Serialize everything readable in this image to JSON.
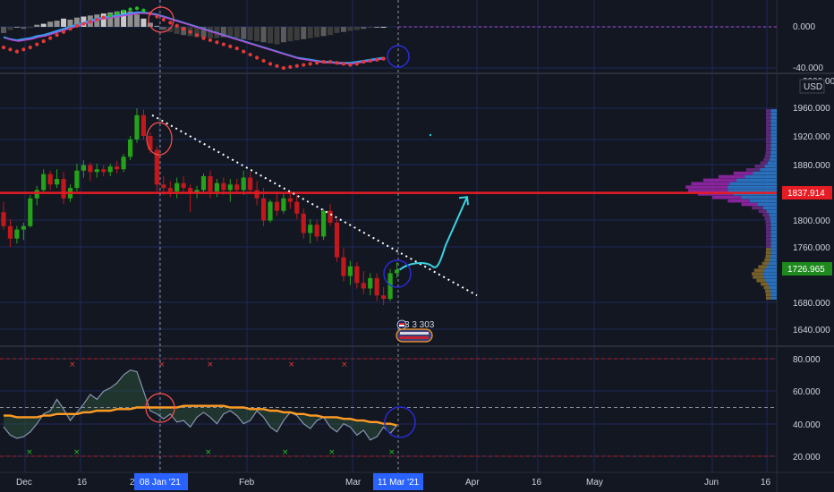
{
  "colors": {
    "background": "#131722",
    "grid": "#1e2a5a",
    "candle_up": "#26a21a",
    "candle_down": "#c2181b",
    "resistance": "#e51c23",
    "forecast": "#3ad2e0",
    "macd_signal": "#b34bd1",
    "macd_line": "#2ea1f2",
    "rsi_ma": "#ff9b24",
    "rsi_line": "#8795b0",
    "marker_circle_red": "#ff5050",
    "marker_circle_blue": "#2b2bd6"
  },
  "header": {
    "currency": "USD"
  },
  "x_axis": {
    "labels": [
      "Dec",
      "16",
      "2",
      "Feb",
      "Mar",
      "Apr",
      "16",
      "May",
      "Jun",
      "16"
    ],
    "highlight_labels": [
      "08 Jan '21",
      "11 Mar '21"
    ]
  },
  "price_panel": {
    "y_ticks": [
      "1960.000",
      "1920.000",
      "1880.000",
      "1800.000",
      "1760.000",
      "1680.000",
      "1640.000"
    ],
    "partial_top_label": "2000.000",
    "resistance_label": "1837.914",
    "last_price_label": "1726.965",
    "badge_text": "3 3 303",
    "icon_names": [
      "flag-icon",
      "event-icon"
    ]
  },
  "macd_panel": {
    "y_ticks": [
      "0.000",
      "-40.000"
    ]
  },
  "rsi_panel": {
    "y_ticks": [
      "80.000",
      "60.000",
      "40.000",
      "20.000"
    ]
  },
  "chart_data": [
    {
      "type": "candlestick",
      "title": "",
      "ylim": [
        1620,
        2000
      ],
      "resistance_level": 1837.914,
      "last_price": 1726.965,
      "candles": [
        [
          1810,
          1825,
          1785,
          1790
        ],
        [
          1790,
          1800,
          1760,
          1772
        ],
        [
          1772,
          1790,
          1765,
          1785
        ],
        [
          1785,
          1795,
          1770,
          1790
        ],
        [
          1790,
          1835,
          1788,
          1830
        ],
        [
          1830,
          1848,
          1820,
          1842
        ],
        [
          1842,
          1872,
          1838,
          1865
        ],
        [
          1865,
          1870,
          1842,
          1850
        ],
        [
          1850,
          1872,
          1845,
          1858
        ],
        [
          1858,
          1868,
          1822,
          1830
        ],
        [
          1830,
          1850,
          1825,
          1845
        ],
        [
          1845,
          1880,
          1840,
          1870
        ],
        [
          1870,
          1885,
          1860,
          1878
        ],
        [
          1878,
          1882,
          1855,
          1868
        ],
        [
          1868,
          1880,
          1860,
          1872
        ],
        [
          1872,
          1878,
          1862,
          1868
        ],
        [
          1868,
          1880,
          1862,
          1876
        ],
        [
          1876,
          1884,
          1866,
          1872
        ],
        [
          1872,
          1894,
          1868,
          1890
        ],
        [
          1890,
          1920,
          1885,
          1915
        ],
        [
          1915,
          1960,
          1910,
          1950
        ],
        [
          1950,
          1958,
          1915,
          1920
        ],
        [
          1920,
          1925,
          1895,
          1900
        ],
        [
          1900,
          1905,
          1840,
          1850
        ],
        [
          1850,
          1862,
          1835,
          1845
        ],
        [
          1845,
          1855,
          1832,
          1840
        ],
        [
          1840,
          1860,
          1830,
          1852
        ],
        [
          1852,
          1862,
          1838,
          1845
        ],
        [
          1845,
          1850,
          1810,
          1838
        ],
        [
          1838,
          1848,
          1830,
          1842
        ],
        [
          1842,
          1866,
          1838,
          1862
        ],
        [
          1862,
          1870,
          1830,
          1840
        ],
        [
          1840,
          1858,
          1832,
          1852
        ],
        [
          1852,
          1860,
          1835,
          1842
        ],
        [
          1842,
          1858,
          1825,
          1850
        ],
        [
          1850,
          1858,
          1838,
          1842
        ],
        [
          1842,
          1870,
          1835,
          1860
        ],
        [
          1860,
          1868,
          1838,
          1842
        ],
        [
          1842,
          1855,
          1820,
          1830
        ],
        [
          1830,
          1845,
          1790,
          1798
        ],
        [
          1798,
          1828,
          1795,
          1825
        ],
        [
          1825,
          1840,
          1805,
          1812
        ],
        [
          1812,
          1836,
          1808,
          1830
        ],
        [
          1830,
          1840,
          1815,
          1825
        ],
        [
          1825,
          1835,
          1800,
          1808
        ],
        [
          1808,
          1815,
          1772,
          1780
        ],
        [
          1780,
          1800,
          1765,
          1792
        ],
        [
          1792,
          1798,
          1768,
          1775
        ],
        [
          1775,
          1815,
          1770,
          1812
        ],
        [
          1812,
          1822,
          1790,
          1795
        ],
        [
          1795,
          1800,
          1738,
          1745
        ],
        [
          1745,
          1758,
          1710,
          1718
        ],
        [
          1718,
          1740,
          1705,
          1732
        ],
        [
          1732,
          1738,
          1700,
          1708
        ],
        [
          1708,
          1725,
          1692,
          1700
        ],
        [
          1700,
          1722,
          1690,
          1715
        ],
        [
          1715,
          1722,
          1682,
          1690
        ],
        [
          1690,
          1702,
          1676,
          1685
        ],
        [
          1685,
          1728,
          1682,
          1722
        ],
        [
          1722,
          1738,
          1715,
          1726.965
        ]
      ],
      "trendline": {
        "from": [
          "08 Jan '21",
          1950
        ],
        "to": [
          "Apr",
          1690
        ]
      },
      "forecast_path": [
        [
          1726.965,
          1740
        ],
        [
          1760,
          1768
        ],
        [
          1825,
          1832
        ]
      ]
    },
    {
      "type": "bar",
      "title": "",
      "ylim": [
        -45,
        15
      ],
      "histogram": [
        -6,
        -3,
        0,
        -2,
        -1,
        2,
        3,
        5,
        6,
        8,
        7,
        9,
        10,
        11,
        12,
        13,
        14,
        15,
        16,
        15,
        12,
        8,
        4,
        1,
        -3,
        -5,
        -7,
        -8,
        -9,
        -10,
        -10,
        -11,
        -11,
        -10,
        -9,
        -11,
        -12,
        -13,
        -14,
        -15,
        -16,
        -17,
        -15,
        -14,
        -13,
        -12,
        -11,
        -10,
        -9,
        -8,
        -6,
        -5,
        -4,
        -3,
        -2,
        -1,
        0,
        0
      ],
      "series": [
        {
          "name": "",
          "values": [
            -10,
            -12,
            -13,
            -12,
            -11,
            -9,
            -8,
            -6,
            -4,
            -2,
            0,
            2,
            4,
            6,
            8,
            9,
            10,
            11,
            12,
            13,
            14,
            14,
            13,
            12,
            10,
            8,
            6,
            4,
            2,
            0,
            -2,
            -4,
            -6,
            -8,
            -10,
            -12,
            -14,
            -16,
            -18,
            -20,
            -22,
            -24,
            -26,
            -28,
            -30,
            -31,
            -32,
            -33,
            -34,
            -34,
            -35,
            -35,
            -35,
            -34,
            -33,
            -32,
            -31,
            -30
          ]
        },
        {
          "name": "",
          "values": [
            -20,
            -22,
            -24,
            -22,
            -20,
            -17,
            -14,
            -11,
            -8,
            -5,
            -2,
            1,
            3,
            5,
            7,
            9,
            11,
            13,
            15,
            17,
            18,
            16,
            13,
            10,
            7,
            4,
            1,
            -2,
            -5,
            -8,
            -11,
            -13,
            -15,
            -17,
            -19,
            -21,
            -24,
            -27,
            -30,
            -33,
            -36,
            -38,
            -40,
            -39,
            -38,
            -37,
            -36,
            -35,
            -34,
            -34,
            -35,
            -36,
            -37,
            -36,
            -34,
            -33,
            -32,
            -31
          ]
        }
      ]
    },
    {
      "type": "line",
      "title": "",
      "ylim": [
        15,
        90
      ],
      "series": [
        {
          "name": "",
          "values": [
            38,
            33,
            31,
            32,
            35,
            40,
            46,
            48,
            55,
            49,
            42,
            47,
            52,
            58,
            55,
            60,
            62,
            65,
            70,
            73,
            72,
            60,
            48,
            46,
            43,
            46,
            41,
            42,
            38,
            44,
            47,
            44,
            40,
            46,
            48,
            45,
            40,
            42,
            48,
            44,
            38,
            35,
            42,
            47,
            45,
            40,
            37,
            42,
            44,
            38,
            35,
            40,
            38,
            33,
            36,
            30,
            32,
            38,
            34,
            39
          ]
        },
        {
          "name": "",
          "values": [
            45,
            45,
            44,
            44,
            44,
            44,
            45,
            45,
            46,
            46,
            46,
            46,
            47,
            47,
            48,
            48,
            48,
            49,
            49,
            49,
            50,
            50,
            50,
            50,
            50,
            50,
            50,
            51,
            51,
            51,
            51,
            51,
            51,
            51,
            50,
            50,
            50,
            49,
            49,
            49,
            48,
            48,
            47,
            47,
            46,
            46,
            45,
            45,
            44,
            44,
            44,
            43,
            43,
            42,
            42,
            41,
            41,
            40,
            40,
            39
          ]
        }
      ],
      "reference_lines": [
        80,
        50,
        20
      ]
    }
  ]
}
